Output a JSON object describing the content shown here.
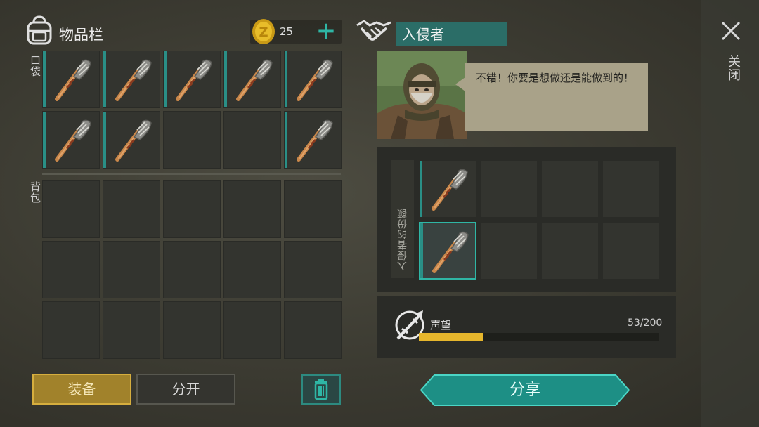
{
  "inventory": {
    "title": "物品栏",
    "coins": "25",
    "plus_label": "+",
    "pocket_label": "口袋",
    "backpack_label": "背包"
  },
  "buttons": {
    "equip": "装备",
    "split": "分开",
    "share": "分享"
  },
  "trader": {
    "name": "入侵者",
    "dialog": "不错！你要是想做还是能做到的！",
    "share_label": "入侵者的份额"
  },
  "reputation": {
    "label": "声望",
    "value_text": "53/200",
    "current": 53,
    "max": 200
  },
  "close_label": "关闭",
  "pocket_slots": [
    {
      "item": "bat-icon"
    },
    {
      "item": "bat-icon"
    },
    {
      "item": "bat-icon"
    },
    {
      "item": "bat-icon"
    },
    {
      "item": "bat-icon"
    },
    {
      "item": "bat-icon"
    },
    {
      "item": "bat-icon"
    },
    {
      "item": null
    },
    {
      "item": null
    },
    {
      "item": "bat-icon"
    }
  ],
  "backpack_slots": [
    null,
    null,
    null,
    null,
    null,
    null,
    null,
    null,
    null,
    null,
    null,
    null,
    null,
    null,
    null
  ],
  "share_slots": [
    {
      "item": "bat-icon",
      "selected": false
    },
    {
      "item": null
    },
    {
      "item": null
    },
    {
      "item": null
    },
    {
      "item": "bat-icon",
      "selected": true
    },
    {
      "item": null
    },
    {
      "item": null
    },
    {
      "item": null
    }
  ],
  "colors": {
    "accent": "#2fb6a5",
    "equip": "#a1822b",
    "reputation": "#e6b62c"
  }
}
